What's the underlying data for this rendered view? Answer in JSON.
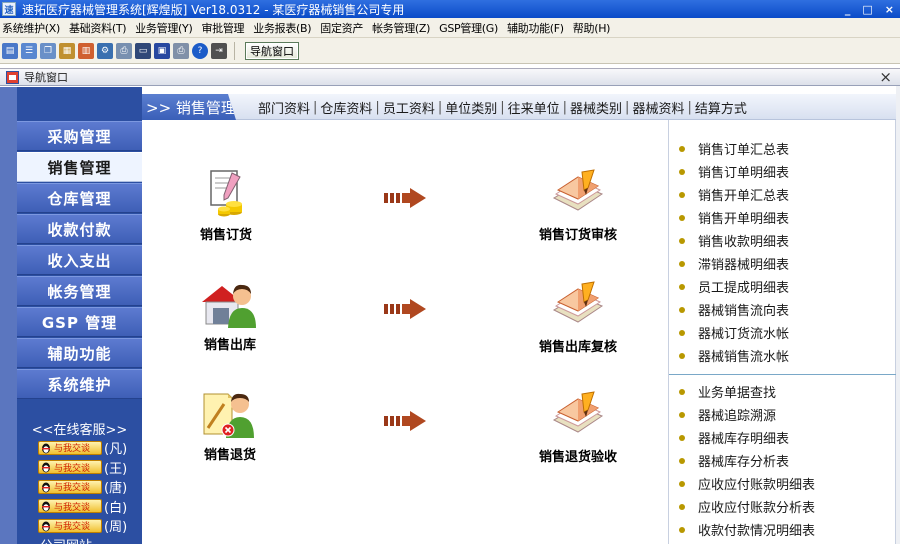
{
  "window": {
    "title": "速拓医疗器械管理系统[辉煌版] Ver18.0312 - 某医疗器械销售公司专用",
    "minimize": "_",
    "maximize": "□",
    "close": "×"
  },
  "menubar": {
    "items": [
      "系统维护(X)",
      "基础资料(T)",
      "业务管理(Y)",
      "审批管理",
      "业务报表(B)",
      "固定资产",
      "帐务管理(Z)",
      "GSP管理(G)",
      "辅助功能(F)",
      "帮助(H)"
    ]
  },
  "toolbar": {
    "icons": [
      "form-icon",
      "list-icon",
      "window-icon",
      "report-icon",
      "chart-icon",
      "settings-icon",
      "print-preview-icon",
      "monitor-icon",
      "save-icon",
      "print-icon",
      "help-icon",
      "exit-icon"
    ],
    "nav_button_label": "导航窗口"
  },
  "nav_window": {
    "title": "导航窗口",
    "close": "×"
  },
  "sidebar": {
    "items": [
      {
        "label": "采购管理",
        "active": false
      },
      {
        "label": "销售管理",
        "active": true
      },
      {
        "label": "仓库管理",
        "active": false
      },
      {
        "label": "收款付款",
        "active": false
      },
      {
        "label": "收入支出",
        "active": false
      },
      {
        "label": "帐务管理",
        "active": false
      },
      {
        "label": "GSP 管理",
        "active": false
      },
      {
        "label": "辅助功能",
        "active": false
      },
      {
        "label": "系统维护",
        "active": false
      }
    ],
    "online_title": "<<在线客服>>",
    "online_button_label": "与我交谈",
    "online_staff": [
      "(凡)",
      "(王)",
      "(唐)",
      "(白)",
      "(周)"
    ],
    "more_label": "公司网站"
  },
  "tabs": {
    "active": ">> 销售管理",
    "links": [
      "部门资料",
      "仓库资料",
      "员工资料",
      "单位类别",
      "往来单位",
      "器械类别",
      "器械资料",
      "结算方式"
    ]
  },
  "flow": {
    "rows": [
      {
        "left": "销售订货",
        "right": "销售订货审核"
      },
      {
        "left": "销售出库",
        "right": "销售出库复核"
      },
      {
        "left": "销售退货",
        "right": "销售退货验收"
      }
    ]
  },
  "reports": {
    "group1": [
      "销售订单汇总表",
      "销售订单明细表",
      "销售开单汇总表",
      "销售开单明细表",
      "销售收款明细表",
      "滞销器械明细表",
      "员工提成明细表",
      "器械销售流向表",
      "器械订货流水帐",
      "器械销售流水帐"
    ],
    "group2": [
      "业务单据查找",
      "器械追踪溯源",
      "器械库存明细表",
      "器械库存分析表",
      "应收应付账款明细表",
      "应收应付账款分析表",
      "收款付款情况明细表"
    ]
  },
  "colors": {
    "sidebar_bg": "#2c4fa2",
    "sidebar_item": "#4a6ac4",
    "accent_arrow": "#9a3818",
    "bullet": "#b89800"
  }
}
